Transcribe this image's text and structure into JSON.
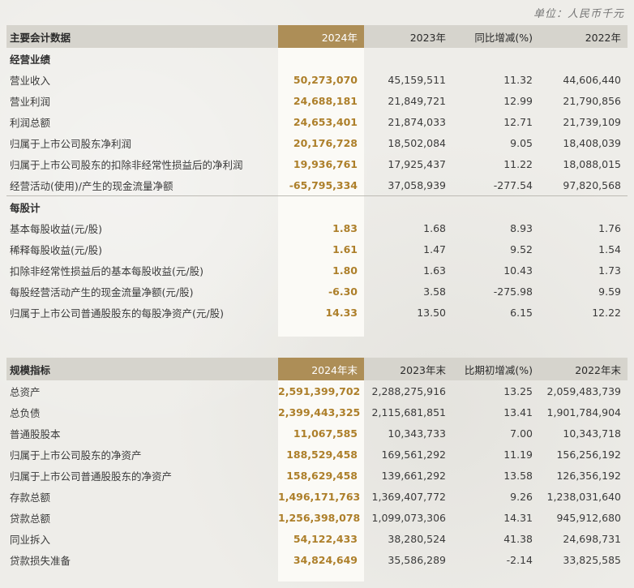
{
  "unit_note": "单位：人民币千元",
  "colors": {
    "highlight_header": "#ad8e57",
    "highlight_value": "#ad7f2a",
    "header_band": "#d6d4cd"
  },
  "table1": {
    "headers": [
      "主要会计数据",
      "2024年",
      "2023年",
      "同比增减(%)",
      "2022年"
    ],
    "sections": [
      {
        "title": "经营业绩",
        "rows": [
          [
            "营业收入",
            "50,273,070",
            "45,159,511",
            "11.32",
            "44,606,440"
          ],
          [
            "营业利润",
            "24,688,181",
            "21,849,721",
            "12.99",
            "21,790,856"
          ],
          [
            "利润总额",
            "24,653,401",
            "21,874,033",
            "12.71",
            "21,739,109"
          ],
          [
            "归属于上市公司股东净利润",
            "20,176,728",
            "18,502,084",
            "9.05",
            "18,408,039"
          ],
          [
            "归属于上市公司股东的扣除非经常性损益后的净利润",
            "19,936,761",
            "17,925,437",
            "11.22",
            "18,088,015"
          ],
          [
            "经营活动(使用)/产生的现金流量净额",
            "-65,795,334",
            "37,058,939",
            "-277.54",
            "97,820,568"
          ]
        ]
      },
      {
        "title": "每股计",
        "rows": [
          [
            "基本每股收益(元/股)",
            "1.83",
            "1.68",
            "8.93",
            "1.76"
          ],
          [
            "稀释每股收益(元/股)",
            "1.61",
            "1.47",
            "9.52",
            "1.54"
          ],
          [
            "扣除非经常性损益后的基本每股收益(元/股)",
            "1.80",
            "1.63",
            "10.43",
            "1.73"
          ],
          [
            "每股经营活动产生的现金流量净额(元/股)",
            "-6.30",
            "3.58",
            "-275.98",
            "9.59"
          ],
          [
            "归属于上市公司普通股股东的每股净资产(元/股)",
            "14.33",
            "13.50",
            "6.15",
            "12.22"
          ]
        ]
      }
    ]
  },
  "table2": {
    "headers": [
      "规模指标",
      "2024年末",
      "2023年末",
      "比期初增减(%)",
      "2022年末"
    ],
    "rows": [
      [
        "总资产",
        "2,591,399,702",
        "2,288,275,916",
        "13.25",
        "2,059,483,739"
      ],
      [
        "总负债",
        "2,399,443,325",
        "2,115,681,851",
        "13.41",
        "1,901,784,904"
      ],
      [
        "普通股股本",
        "11,067,585",
        "10,343,733",
        "7.00",
        "10,343,718"
      ],
      [
        "归属于上市公司股东的净资产",
        "188,529,458",
        "169,561,292",
        "11.19",
        "156,256,192"
      ],
      [
        "归属于上市公司普通股股东的净资产",
        "158,629,458",
        "139,661,292",
        "13.58",
        "126,356,192"
      ],
      [
        "存款总额",
        "1,496,171,763",
        "1,369,407,772",
        "9.26",
        "1,238,031,640"
      ],
      [
        "贷款总额",
        "1,256,398,078",
        "1,099,073,306",
        "14.31",
        "945,912,680"
      ],
      [
        "同业拆入",
        "54,122,433",
        "38,280,524",
        "41.38",
        "24,698,731"
      ],
      [
        "贷款损失准备",
        "34,824,649",
        "35,586,289",
        "-2.14",
        "33,825,585"
      ]
    ]
  }
}
